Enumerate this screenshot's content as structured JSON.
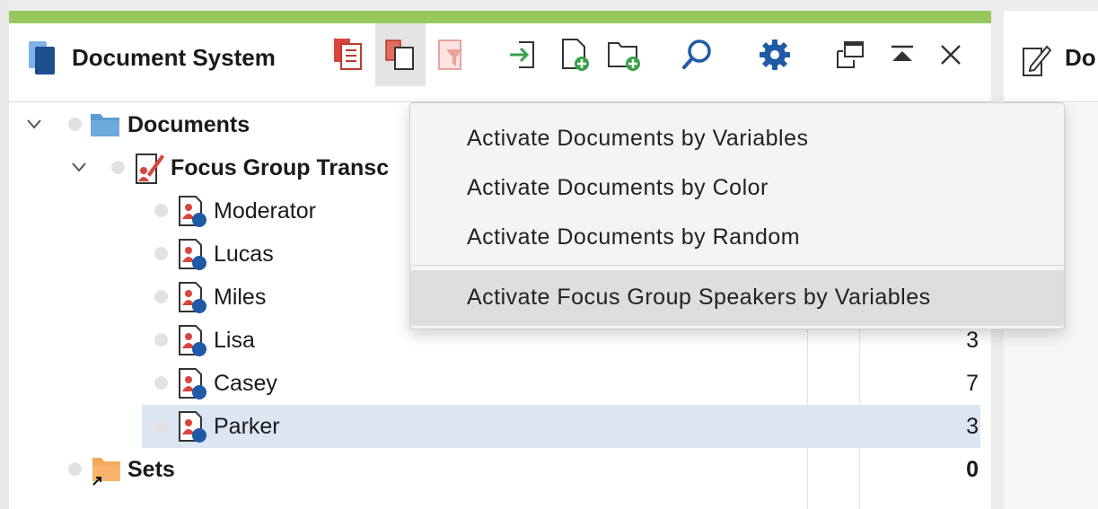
{
  "panel": {
    "title": "Document System"
  },
  "toolbar": {
    "buttons": [
      {
        "name": "activate-documents-icon"
      },
      {
        "name": "activate-menu-icon"
      },
      {
        "name": "filter-icon"
      },
      {
        "name": "import-icon"
      },
      {
        "name": "new-document-icon"
      },
      {
        "name": "new-folder-icon"
      },
      {
        "name": "search-icon"
      },
      {
        "name": "gear-icon"
      },
      {
        "name": "undock-window-icon"
      },
      {
        "name": "collapse-panel-icon"
      },
      {
        "name": "close-icon"
      }
    ]
  },
  "tree": {
    "root": {
      "label": "Documents"
    },
    "group": {
      "label": "Focus Group Transc"
    },
    "speakers": [
      {
        "label": "Moderator",
        "count": ""
      },
      {
        "label": "Lucas",
        "count": ""
      },
      {
        "label": "Miles",
        "count": ""
      },
      {
        "label": "Lisa",
        "count": "3"
      },
      {
        "label": "Casey",
        "count": "7"
      },
      {
        "label": "Parker",
        "count": "3"
      }
    ],
    "sets": {
      "label": "Sets",
      "count": "0"
    }
  },
  "menu": {
    "items": [
      "Activate Documents by Variables",
      "Activate Documents by Color",
      "Activate Documents by Random",
      "Activate Focus Group Speakers by Variables"
    ]
  },
  "right_panel": {
    "title": "Do"
  },
  "colors": {
    "accent_green": "#97c85e",
    "icon_red": "#d9453b",
    "icon_blue": "#1f5aa6",
    "selection": "#dbe6f2"
  }
}
